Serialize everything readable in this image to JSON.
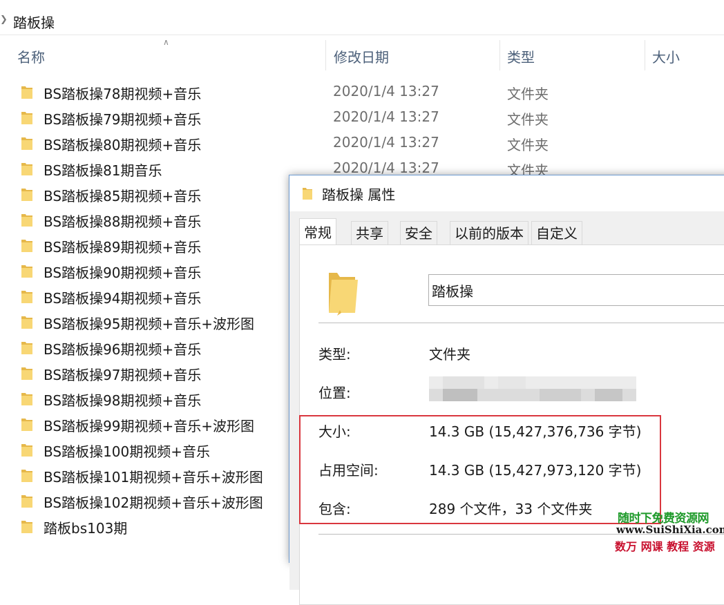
{
  "breadcrumb": {
    "current": "踏板操"
  },
  "columns": {
    "name": "名称",
    "modified": "修改日期",
    "type": "类型",
    "size": "大小"
  },
  "files": [
    {
      "name": "BS踏板操78期视频+音乐",
      "modified": "2020/1/4 13:27",
      "type": "文件夹"
    },
    {
      "name": "BS踏板操79期视频+音乐",
      "modified": "2020/1/4 13:27",
      "type": "文件夹"
    },
    {
      "name": "BS踏板操80期视频+音乐",
      "modified": "2020/1/4 13:27",
      "type": "文件夹"
    },
    {
      "name": "BS踏板操81期音乐",
      "modified": "2020/1/4 13:27",
      "type": "文件夹"
    },
    {
      "name": "BS踏板操85期视频+音乐",
      "modified": "",
      "type": ""
    },
    {
      "name": "BS踏板操88期视频+音乐",
      "modified": "",
      "type": ""
    },
    {
      "name": "BS踏板操89期视频+音乐",
      "modified": "",
      "type": ""
    },
    {
      "name": "BS踏板操90期视频+音乐",
      "modified": "",
      "type": ""
    },
    {
      "name": "BS踏板操94期视频+音乐",
      "modified": "",
      "type": ""
    },
    {
      "name": "BS踏板操95期视频+音乐+波形图",
      "modified": "",
      "type": ""
    },
    {
      "name": "BS踏板操96期视频+音乐",
      "modified": "",
      "type": ""
    },
    {
      "name": "BS踏板操97期视频+音乐",
      "modified": "",
      "type": ""
    },
    {
      "name": "BS踏板操98期视频+音乐",
      "modified": "",
      "type": ""
    },
    {
      "name": "BS踏板操99期视频+音乐+波形图",
      "modified": "",
      "type": ""
    },
    {
      "name": "BS踏板操100期视频+音乐",
      "modified": "",
      "type": ""
    },
    {
      "name": "BS踏板操101期视频+音乐+波形图",
      "modified": "",
      "type": ""
    },
    {
      "name": "BS踏板操102期视频+音乐+波形图",
      "modified": "",
      "type": ""
    },
    {
      "name": "踏板bs103期",
      "modified": "",
      "type": ""
    }
  ],
  "dialog": {
    "title": "踏板操 属性",
    "tabs": [
      "常规",
      "共享",
      "安全",
      "以前的版本",
      "自定义"
    ],
    "active_tab": "常规",
    "folder_name": "踏板操",
    "props": {
      "type_label": "类型:",
      "type_value": "文件夹",
      "location_label": "位置:",
      "size_label": "大小:",
      "size_value": "14.3 GB (15,427,376,736 字节)",
      "disk_label": "占用空间:",
      "disk_value": "14.3 GB (15,427,973,120 字节)",
      "contains_label": "包含:",
      "contains_value": "289 个文件，33 个文件夹"
    }
  },
  "watermark": {
    "line1": "随时下免费资源网",
    "line2": "www.SuiShiXia.com",
    "line3": "数万 网课 教程 资源"
  },
  "colors": {
    "folder_yellow": "#f8d775",
    "folder_dark": "#e6b84a",
    "highlight_red": "#d9363e",
    "header_text": "#4c607a"
  }
}
